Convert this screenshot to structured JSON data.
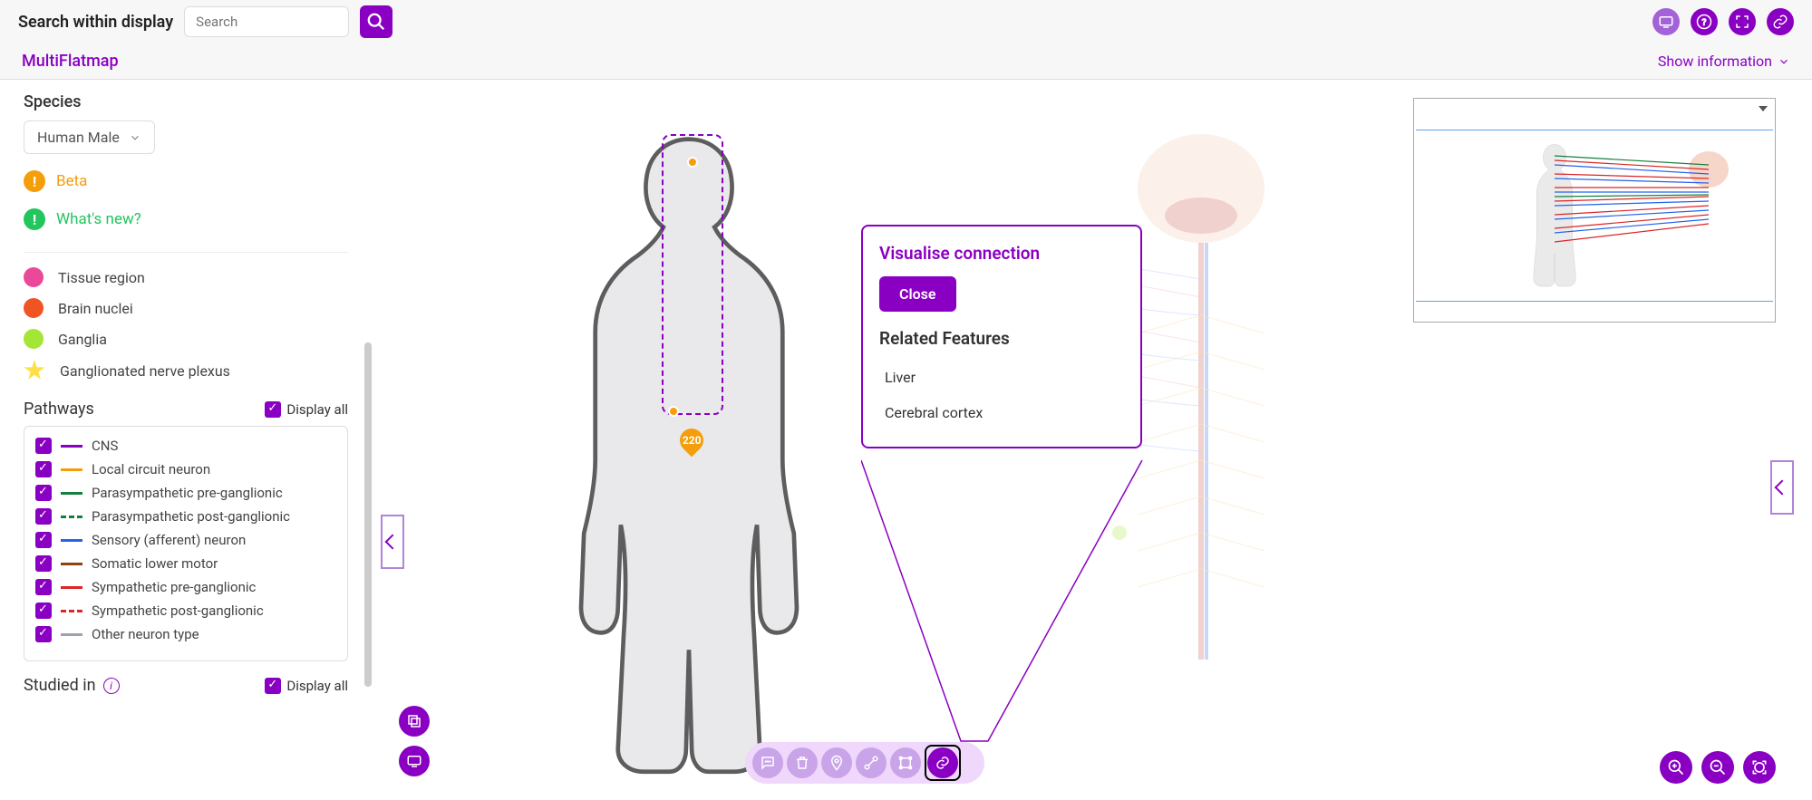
{
  "topbar": {
    "search_label": "Search within display",
    "search_placeholder": "Search"
  },
  "subheader": {
    "title": "MultiFlatmap",
    "show_info": "Show information"
  },
  "sidebar": {
    "species_label": "Species",
    "species_value": "Human Male",
    "beta_label": "Beta",
    "whatsnew_label": "What's new?",
    "legend": {
      "tissue": "Tissue region",
      "nuclei": "Brain nuclei",
      "ganglia": "Ganglia",
      "plexus": "Ganglionated nerve plexus"
    },
    "pathways_label": "Pathways",
    "display_all": "Display all",
    "pathways": {
      "cns": "CNS",
      "local": "Local circuit neuron",
      "parapre": "Parasympathetic pre-ganglionic",
      "parapost": "Parasympathetic post-ganglionic",
      "sensory": "Sensory (afferent) neuron",
      "somatic": "Somatic lower motor",
      "sympre": "Sympathetic pre-ganglionic",
      "sympost": "Sympathetic post-ganglionic",
      "other": "Other neuron type"
    },
    "studied_label": "Studied in"
  },
  "marker": {
    "count": "220"
  },
  "popup": {
    "title": "Visualise connection",
    "close": "Close",
    "related_title": "Related Features",
    "items": {
      "liver": "Liver",
      "cortex": "Cerebral cortex"
    }
  }
}
